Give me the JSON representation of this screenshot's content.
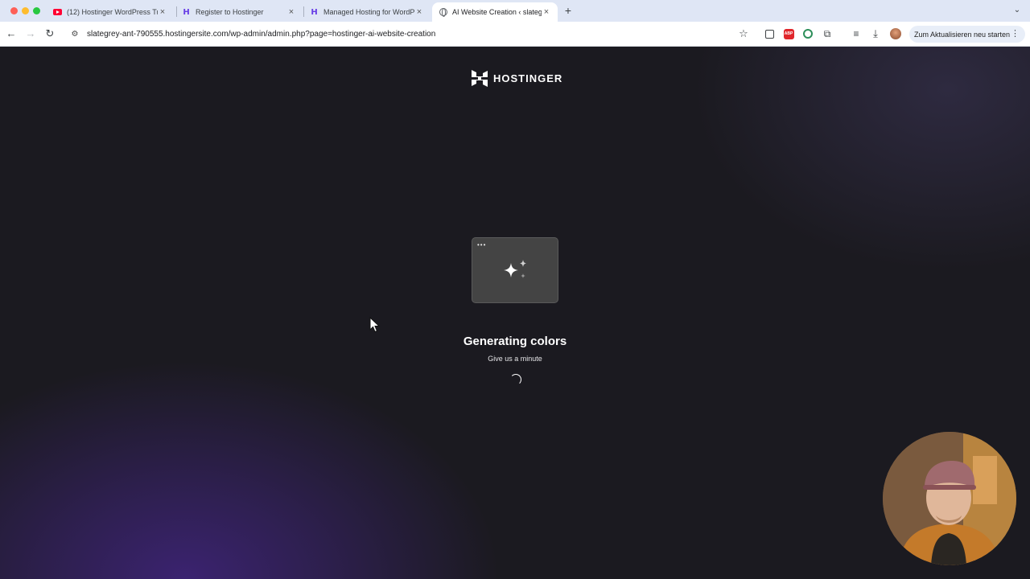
{
  "browser": {
    "tabs": [
      {
        "title": "(12) Hostinger WordPress Tu",
        "favicon": "youtube-icon",
        "active": false
      },
      {
        "title": "Register to Hostinger",
        "favicon": "hostinger-icon",
        "active": false
      },
      {
        "title": "Managed Hosting for WordPr",
        "favicon": "hostinger-icon",
        "active": false
      },
      {
        "title": "AI Website Creation ‹ slategr",
        "favicon": "globe-icon",
        "active": true
      }
    ],
    "close_glyph": "×",
    "new_tab_glyph": "+",
    "tab_menu_glyph": "⌄",
    "url": "slategrey-ant-790555.hostingersite.com/wp-admin/admin.php?page=hostinger-ai-website-creation",
    "update_button_label": "Zum Aktualisieren neu starten",
    "icons": {
      "back": "←",
      "forward": "→",
      "reload": "↻",
      "tune": "⚙",
      "star": "☆",
      "more": "⋮"
    }
  },
  "page": {
    "logo_text": "HOSTINGER",
    "status_title": "Generating colors",
    "status_subtitle": "Give us a minute",
    "window_dots": "•••"
  },
  "colors": {
    "accent_purple": "#673de6",
    "page_background": "#1b1a20",
    "glow": "#3b2370"
  }
}
